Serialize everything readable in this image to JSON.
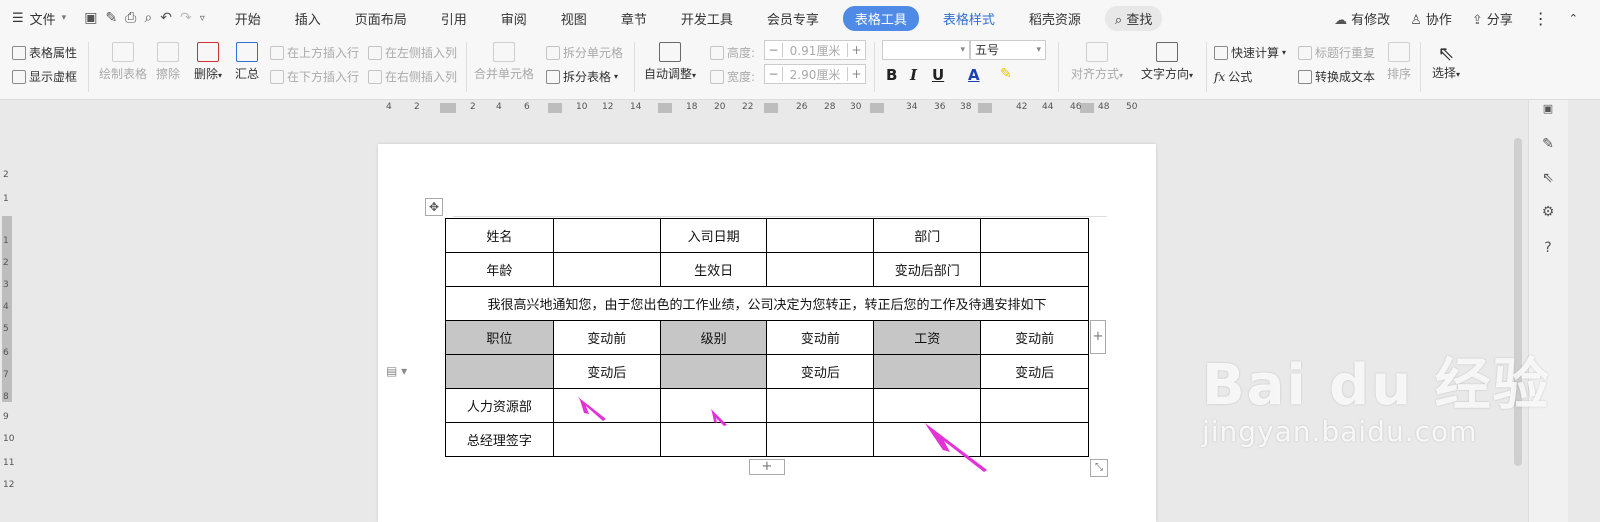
{
  "menubar": {
    "file_label": "文件",
    "tabs": [
      "开始",
      "插入",
      "页面布局",
      "引用",
      "审阅",
      "视图",
      "章节",
      "开发工具",
      "会员专享"
    ],
    "table_tool_tab": "表格工具",
    "table_style_tab": "表格样式",
    "extra_tab": "稻壳资源",
    "search_label": "查找",
    "right": {
      "modified": "有修改",
      "collab": "协作",
      "share": "分享"
    }
  },
  "ribbon": {
    "table_props": "表格属性",
    "show_gridlines": "显示虚框",
    "draw_table": "绘制表格",
    "erase": "擦除",
    "delete": "删除",
    "summary": "汇总",
    "insert_above": "在上方插入行",
    "insert_below": "在下方插入行",
    "insert_left": "在左侧插入列",
    "insert_right": "在右侧插入列",
    "merge_cells": "合并单元格",
    "split_cells": "拆分单元格",
    "split_table": "拆分表格",
    "auto_fit": "自动调整",
    "height_label": "高度:",
    "height_value": "0.91厘米",
    "width_label": "宽度:",
    "width_value": "2.90厘米",
    "font_size": "五号",
    "align": "对齐方式",
    "text_dir": "文字方向",
    "quick_calc": "快速计算",
    "formula": "公式",
    "header_repeat": "标题行重复",
    "to_text": "转换成文本",
    "sort": "排序",
    "select": "选择"
  },
  "ruler": {
    "labels": [
      "4",
      "2",
      "2",
      "4",
      "6",
      "8",
      "10",
      "12",
      "14",
      "16",
      "18",
      "20",
      "22",
      "24",
      "26",
      "28",
      "30",
      "32",
      "34",
      "36",
      "38",
      "40",
      "42",
      "44",
      "46",
      "48",
      "50"
    ],
    "vlabels": [
      "2",
      "1",
      "1",
      "2",
      "3",
      "4",
      "5",
      "6",
      "7",
      "8",
      "9",
      "10",
      "11",
      "12"
    ]
  },
  "table": {
    "rows": [
      [
        "姓名",
        "",
        "入司日期",
        "",
        "部门",
        ""
      ],
      [
        "年龄",
        "",
        "生效日",
        "",
        "变动后部门",
        ""
      ],
      [
        "我很高兴地通知您，由于您出色的工作业绩，公司决定为您转正，转正后您的工作及待遇安排如下"
      ],
      [
        "职位",
        "变动前",
        "级别",
        "变动前",
        "工资",
        "变动前"
      ],
      [
        "",
        "变动后",
        "",
        "变动后",
        "",
        "变动后"
      ],
      [
        "人力资源部",
        "",
        "",
        "",
        "",
        ""
      ],
      [
        "总经理签字",
        "",
        "",
        "",
        "",
        ""
      ]
    ],
    "gray_color": "#c6c6c6"
  },
  "annotations": {
    "arrow_color": "#e233d8"
  },
  "watermark": {
    "brand": "Bai du 经验",
    "url": "jingyan.baidu.com"
  }
}
